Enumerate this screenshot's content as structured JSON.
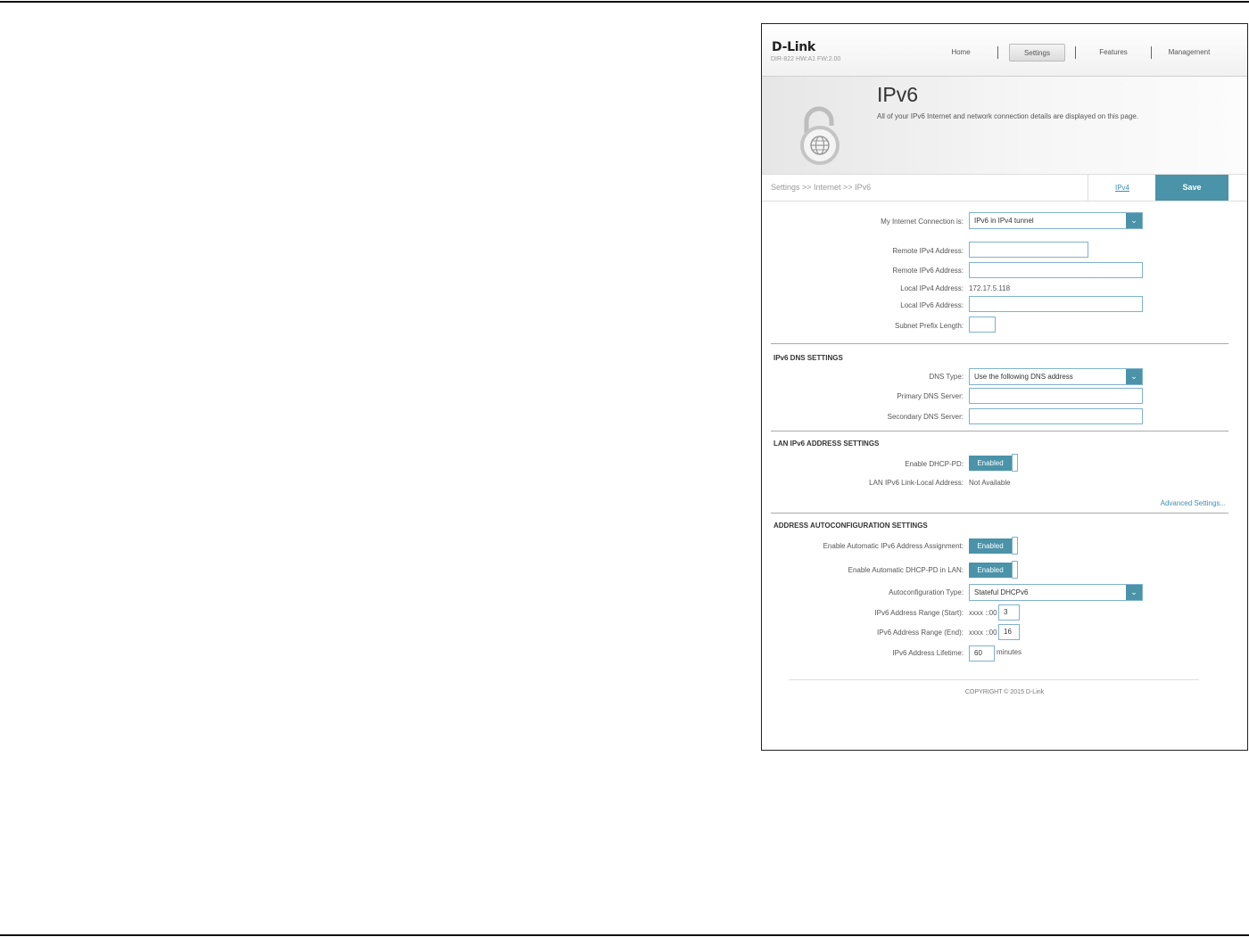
{
  "brand": {
    "logo": "D-Link",
    "model": "DIR-822 HW:A1 FW:2.00"
  },
  "nav": [
    {
      "label": "Home",
      "active": false
    },
    {
      "label": "Settings",
      "active": true
    },
    {
      "label": "Features",
      "active": false
    },
    {
      "label": "Management",
      "active": false
    }
  ],
  "hero": {
    "title": "IPv6",
    "description": "All of your IPv6 Internet and network connection details are displayed on this page."
  },
  "bar": {
    "breadcrumb": "Settings >> Internet >> IPv6",
    "ipv4_link": "IPv4",
    "save": "Save"
  },
  "connection": {
    "type_label": "My Internet Connection is:",
    "type_value": "IPv6 in IPv4 tunnel",
    "remote_ipv4_label": "Remote IPv4 Address:",
    "remote_ipv4": "",
    "remote_ipv6_label": "Remote IPv6 Address:",
    "remote_ipv6": "",
    "local_ipv4_label": "Local IPv4 Address:",
    "local_ipv4": "172.17.5.118",
    "local_ipv6_label": "Local IPv6 Address:",
    "local_ipv6": "",
    "prefix_label": "Subnet Prefix Length:",
    "prefix": ""
  },
  "dns": {
    "title": "IPv6 DNS SETTINGS",
    "type_label": "DNS Type:",
    "type_value": "Use the following DNS address",
    "primary_label": "Primary DNS Server:",
    "primary": "",
    "secondary_label": "Secondary DNS Server:",
    "secondary": ""
  },
  "lan": {
    "title": "LAN IPv6 ADDRESS SETTINGS",
    "dhcppd_label": "Enable DHCP-PD:",
    "dhcppd_value": "Enabled",
    "linklocal_label": "LAN IPv6 Link-Local Address:",
    "linklocal_value": "Not Available",
    "advanced": "Advanced Settings..."
  },
  "autoconf": {
    "title": "ADDRESS AUTOCONFIGURATION SETTINGS",
    "auto_assign_label": "Enable Automatic IPv6 Address Assignment:",
    "auto_assign_value": "Enabled",
    "auto_dhcppd_label": "Enable Automatic DHCP-PD in LAN:",
    "auto_dhcppd_value": "Enabled",
    "type_label": "Autoconfiguration Type:",
    "type_value": "Stateful DHCPv6",
    "range_start_label": "IPv6 Address Range (Start):",
    "range_prefix": "xxxx ::00",
    "range_start": "3",
    "range_end_label": "IPv6 Address Range (End):",
    "range_end": "16",
    "lifetime_label": "IPv6 Address Lifetime:",
    "lifetime": "60",
    "lifetime_unit": "minutes"
  },
  "footer": {
    "copyright": "COPYRIGHT © 2015 D-Link"
  }
}
